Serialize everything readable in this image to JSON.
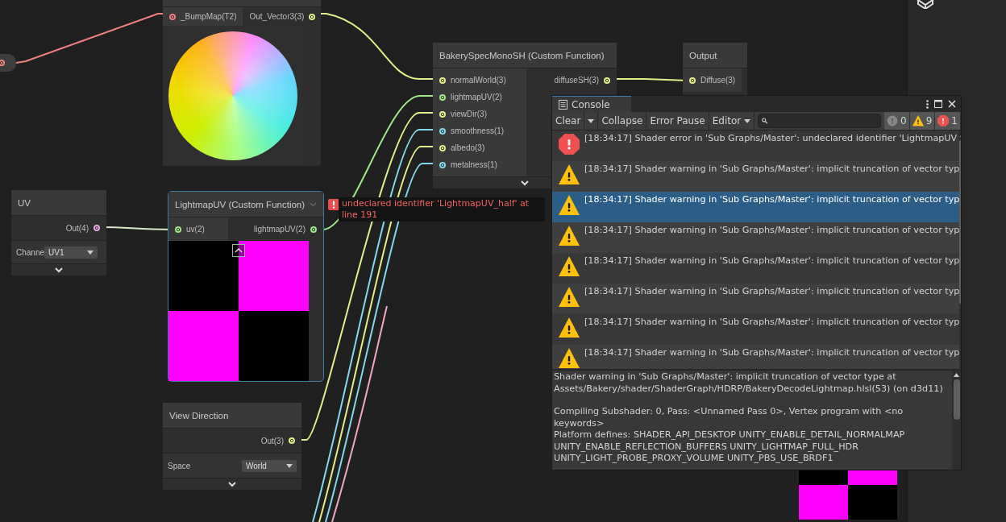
{
  "bump_node": {
    "inputs": [
      {
        "label": "_BumpMap(T2)",
        "color": "#f08080"
      }
    ],
    "outputs": [
      {
        "label": "Out_Vector3(3)",
        "color": "#e4ee8a"
      }
    ]
  },
  "spec_node": {
    "title": "BakerySpecMonoSH (Custom Function)",
    "inputs": [
      {
        "label": "normalWorld(3)",
        "color": "#e4ee8a"
      },
      {
        "label": "lightmapUV(2)",
        "color": "#9ee88a"
      },
      {
        "label": "viewDir(3)",
        "color": "#e4ee8a"
      },
      {
        "label": "smoothness(1)",
        "color": "#84d8ec"
      },
      {
        "label": "albedo(3)",
        "color": "#e4ee8a"
      },
      {
        "label": "metalness(1)",
        "color": "#84d8ec"
      }
    ],
    "outputs": [
      {
        "label": "diffuseSH(3)",
        "color": "#e4ee8a"
      }
    ]
  },
  "output_node": {
    "title": "Output",
    "inputs": [
      {
        "label": "Diffuse(3)",
        "color": "#e4ee8a"
      }
    ]
  },
  "uv_node": {
    "title": "UV",
    "outputs": [
      {
        "label": "Out(4)",
        "color": "#e8a6e8"
      }
    ],
    "field_label": "Channe",
    "dropdown": "UV1"
  },
  "lightmap_node": {
    "title": "LightmapUV (Custom Function)",
    "selected": true,
    "inputs": [
      {
        "label": "uv(2)",
        "color": "#9ee88a"
      }
    ],
    "outputs": [
      {
        "label": "lightmapUV(2)",
        "color": "#9ee88a"
      }
    ],
    "error": "undeclared identifier 'LightmapUV_half' at line 191"
  },
  "view_node": {
    "title": "View Direction",
    "outputs": [
      {
        "label": "Out(3)",
        "color": "#e4ee8a"
      }
    ],
    "field_label": "Space",
    "dropdown": "World"
  },
  "console": {
    "title": "Console",
    "toolbar": {
      "clear": "Clear",
      "collapse": "Collapse",
      "error_pause": "Error Pause",
      "editor": "Editor"
    },
    "counts": [
      {
        "kind": "info",
        "count": "0"
      },
      {
        "kind": "warning",
        "count": "9"
      },
      {
        "kind": "error",
        "count": "1"
      }
    ],
    "entries": [
      {
        "kind": "error",
        "text": "[18:34:17] Shader error in 'Sub Graphs/Master': undeclared identifier 'LightmapUV",
        "selected": false
      },
      {
        "kind": "warning",
        "text": "[18:34:17] Shader warning in 'Sub Graphs/Master': implicit truncation of vector typ",
        "selected": false
      },
      {
        "kind": "warning",
        "text": "[18:34:17] Shader warning in 'Sub Graphs/Master': implicit truncation of vector typ",
        "selected": true
      },
      {
        "kind": "warning",
        "text": "[18:34:17] Shader warning in 'Sub Graphs/Master': implicit truncation of vector typ",
        "selected": false
      },
      {
        "kind": "warning",
        "text": "[18:34:17] Shader warning in 'Sub Graphs/Master': implicit truncation of vector typ",
        "selected": false
      },
      {
        "kind": "warning",
        "text": "[18:34:17] Shader warning in 'Sub Graphs/Master': implicit truncation of vector typ",
        "selected": false
      },
      {
        "kind": "warning",
        "text": "[18:34:17] Shader warning in 'Sub Graphs/Master': implicit truncation of vector typ",
        "selected": false
      },
      {
        "kind": "warning",
        "text": "[18:34:17] Shader warning in 'Sub Graphs/Master': implicit truncation of vector typ",
        "selected": false
      }
    ],
    "detail": [
      "Shader warning in 'Sub Graphs/Master': implicit truncation of vector type at Assets/Bakery/shader/ShaderGraph/HDRP/BakeryDecodeLightmap.hlsl(53) (on d3d11)",
      "Compiling Subshader: 0, Pass: <Unnamed Pass 0>, Vertex program with <no keywords>",
      "Platform defines: SHADER_API_DESKTOP UNITY_ENABLE_DETAIL_NORMALMAP UNITY_ENABLE_REFLECTION_BUFFERS UNITY_LIGHTMAP_FULL_HDR UNITY_LIGHT_PROBE_PROXY_VOLUME UNITY_PBS_USE_BRDF1"
    ]
  }
}
